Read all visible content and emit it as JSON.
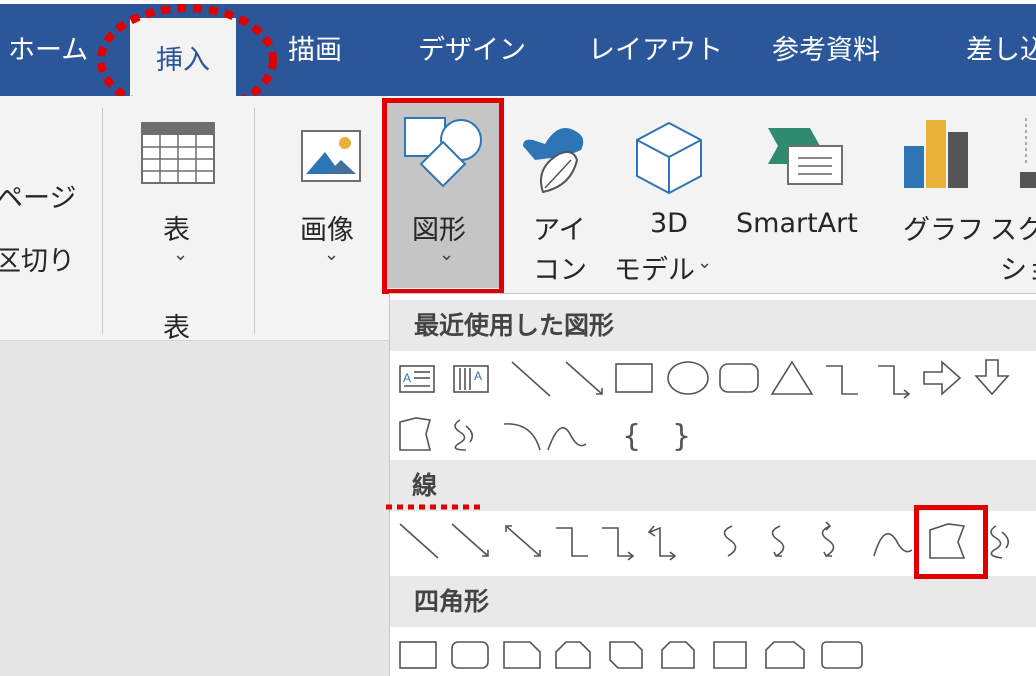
{
  "tabs": [
    "ホーム",
    "挿入",
    "描画",
    "デザイン",
    "レイアウト",
    "参考資料",
    "差し込"
  ],
  "ribbon": {
    "page_partial_1": "ページ",
    "page_partial_2": "区切り",
    "table_label": "表",
    "table_group": "表",
    "image_label": "画像",
    "shapes_label": "図形",
    "icons_label_1": "アイ",
    "icons_label_2": "コン",
    "model3d_label_1": "3D",
    "model3d_label_2": "モデル",
    "smartart_label": "SmartArt",
    "chart_label": "グラフ",
    "screenshot_label_1": "スク",
    "screenshot_label_2": "ショ",
    "chevron": "⌄"
  },
  "shapes_panel": {
    "recent_title": "最近使用した図形",
    "lines_title": "線",
    "rect_title": "四角形"
  },
  "colors": {
    "tab_blue": "#2b579a",
    "highlight_red": "#e00000",
    "shape_blue": "#2e75b6"
  }
}
